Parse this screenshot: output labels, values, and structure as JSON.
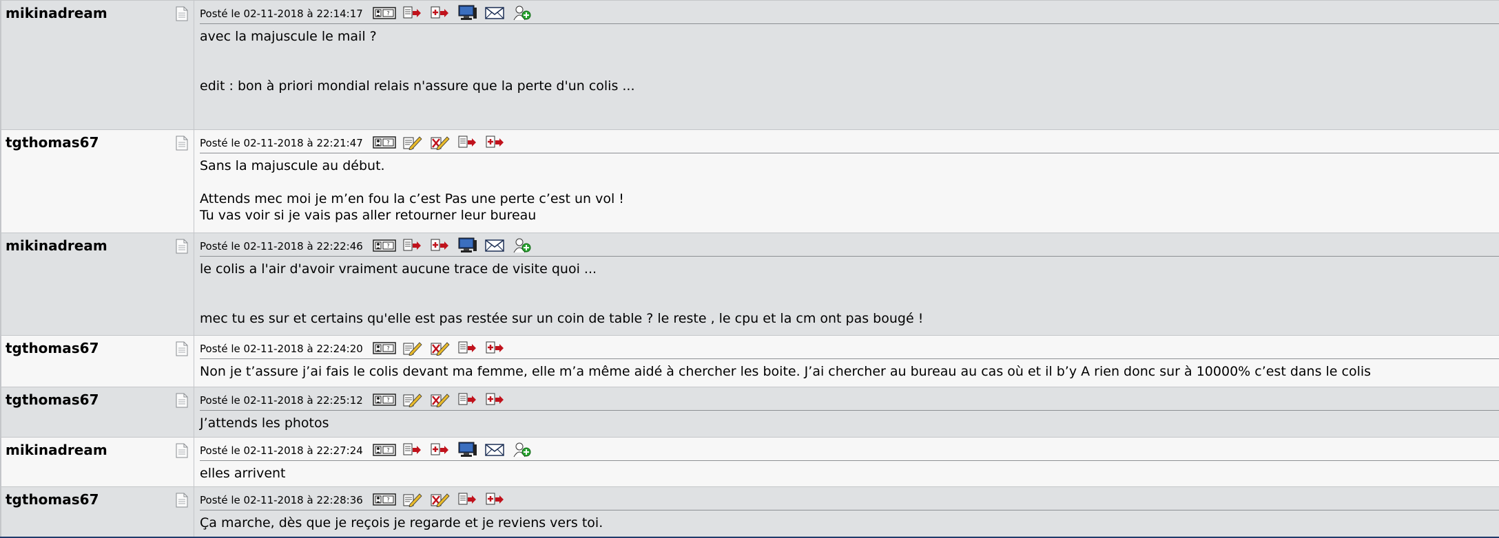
{
  "posts": [
    {
      "author": "mikinadream",
      "date": "Posté le 02-11-2018 à 22:14:17",
      "tools": [
        "profile-card-icon",
        "quote-icon",
        "multi-quote-icon",
        "computer-icon",
        "mail-icon",
        "add-friend-icon"
      ],
      "lines": [
        "avec la majuscule le mail ?",
        "",
        "edit : bon à priori mondial relais n'assure que la perte d'un colis ..."
      ]
    },
    {
      "author": "tgthomas67",
      "date": "Posté le 02-11-2018 à 22:21:47",
      "tools": [
        "profile-card-icon",
        "edit-icon",
        "edit-delete-icon",
        "quote-icon",
        "multi-quote-icon"
      ],
      "lines": [
        "Sans la majuscule au début.",
        "",
        "Attends mec moi je m’en fou la c’est Pas une perte c’est un vol !",
        "Tu vas voir si je vais pas aller retourner leur bureau"
      ]
    },
    {
      "author": "mikinadream",
      "date": "Posté le 02-11-2018 à 22:22:46",
      "tools": [
        "profile-card-icon",
        "quote-icon",
        "multi-quote-icon",
        "computer-icon",
        "mail-icon",
        "add-friend-icon"
      ],
      "lines": [
        "le colis a l'air d'avoir vraiment aucune trace de visite quoi ...",
        "",
        "mec tu es sur et certains qu'elle est pas restée sur un coin de table ? le reste , le cpu et la cm ont pas bougé !"
      ]
    },
    {
      "author": "tgthomas67",
      "date": "Posté le 02-11-2018 à 22:24:20",
      "tools": [
        "profile-card-icon",
        "edit-icon",
        "edit-delete-icon",
        "quote-icon",
        "multi-quote-icon"
      ],
      "lines": [
        "Non je t’assure j’ai fais le colis devant ma femme, elle m’a même aidé à chercher les boite. J’ai chercher au bureau au cas où et il b’y A rien donc sur à 10000% c’est dans le colis"
      ]
    },
    {
      "author": "tgthomas67",
      "date": "Posté le 02-11-2018 à 22:25:12",
      "tools": [
        "profile-card-icon",
        "edit-icon",
        "edit-delete-icon",
        "quote-icon",
        "multi-quote-icon"
      ],
      "lines": [
        "J’attends les photos"
      ]
    },
    {
      "author": "mikinadream",
      "date": "Posté le 02-11-2018 à 22:27:24",
      "tools": [
        "profile-card-icon",
        "quote-icon",
        "multi-quote-icon",
        "computer-icon",
        "mail-icon",
        "add-friend-icon"
      ],
      "lines": [
        "elles arrivent"
      ]
    },
    {
      "author": "tgthomas67",
      "date": "Posté le 02-11-2018 à 22:28:36",
      "tools": [
        "profile-card-icon",
        "edit-icon",
        "edit-delete-icon",
        "quote-icon",
        "multi-quote-icon"
      ],
      "lines": [
        "Ça marche, dès que je reçois je regarde et je reviens vers toi."
      ]
    }
  ]
}
